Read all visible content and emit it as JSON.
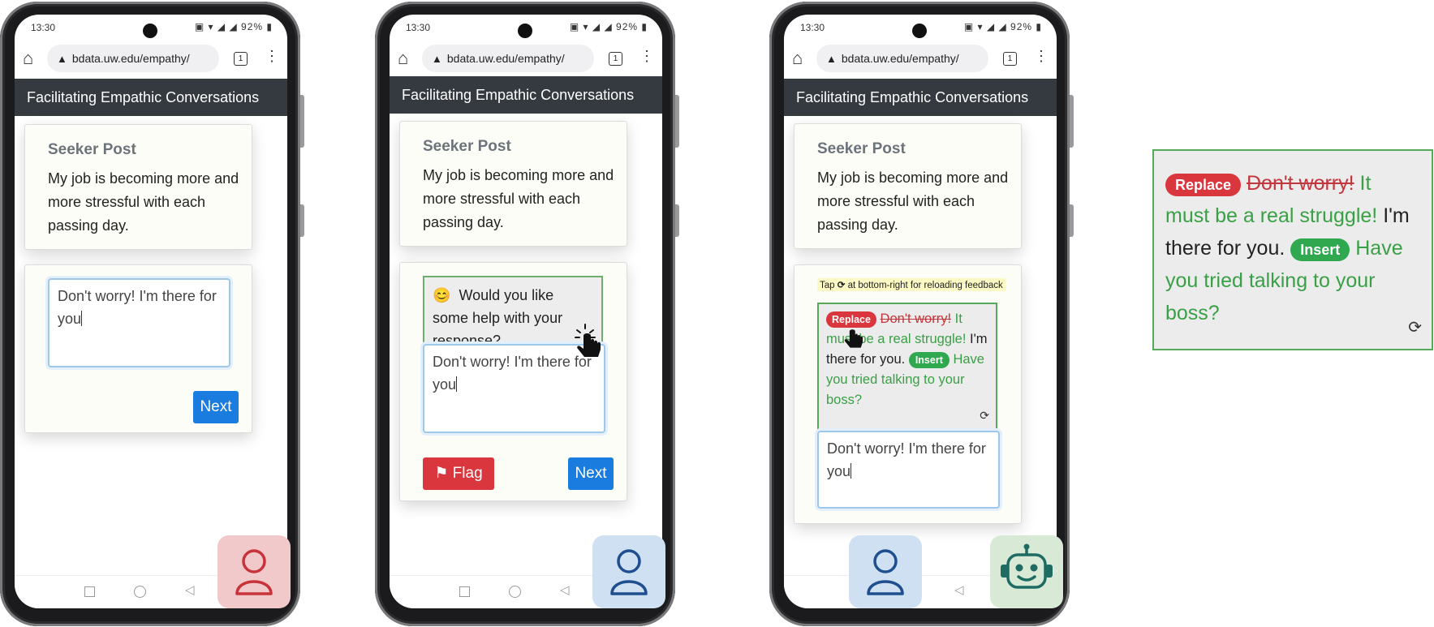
{
  "phones": [
    {
      "status": {
        "time": "13:30",
        "battery": "92%"
      },
      "url": "bdata.uw.edu/empathy/",
      "tab_count": "1",
      "app_title": "Facilitating Empathic Conversations",
      "seeker_title": "Seeker Post",
      "seeker_text": "My job is becoming more and more stressful with each passing day.",
      "response_text": "Don't worry! I'm there for you",
      "next_label": "Next",
      "avatar": "person-icon"
    },
    {
      "status": {
        "time": "13:30",
        "battery": "92%"
      },
      "url": "bdata.uw.edu/empathy/",
      "tab_count": "1",
      "app_title": "Facilitating Empathic Conversations",
      "seeker_title": "Seeker Post",
      "seeker_text": "My job is becoming more and more stressful with each passing day.",
      "help_emoji": "😊",
      "help_text": "Would you like some help with your response?",
      "response_text": "Don't worry! I'm there for you",
      "flag_label": "Flag",
      "next_label": "Next",
      "avatar": "person-icon"
    },
    {
      "status": {
        "time": "13:30",
        "battery": "92%"
      },
      "url": "bdata.uw.edu/empathy/",
      "tab_count": "1",
      "app_title": "Facilitating Empathic Conversations",
      "seeker_title": "Seeker Post",
      "seeker_text": "My job is becoming more and more stressful with each passing day.",
      "hint_before": "Tap",
      "hint_after": "at bottom-right for reloading feedback",
      "response_text": "Don't worry! I'm there for you",
      "avatars": [
        "person-icon",
        "robot-icon"
      ]
    }
  ],
  "feedback": {
    "replace_label": "Replace",
    "removed_text": "Don't worry!",
    "replacement_text": "It must be a real struggle!",
    "kept_text": "I'm there for you.",
    "insert_label": "Insert",
    "inserted_text": "Have you tried talking to your boss?"
  },
  "colors": {
    "header_bg": "#343a40",
    "primary_blue": "#1a7cdf",
    "danger_red": "#d9363e",
    "insert_green": "#2fa84f",
    "suggestion_text_green": "#3aa046",
    "person_avatar_red_bg": "#f2c9cb",
    "person_avatar_blue_bg": "#cfe0f3",
    "robot_avatar_bg": "#d8ead6"
  }
}
